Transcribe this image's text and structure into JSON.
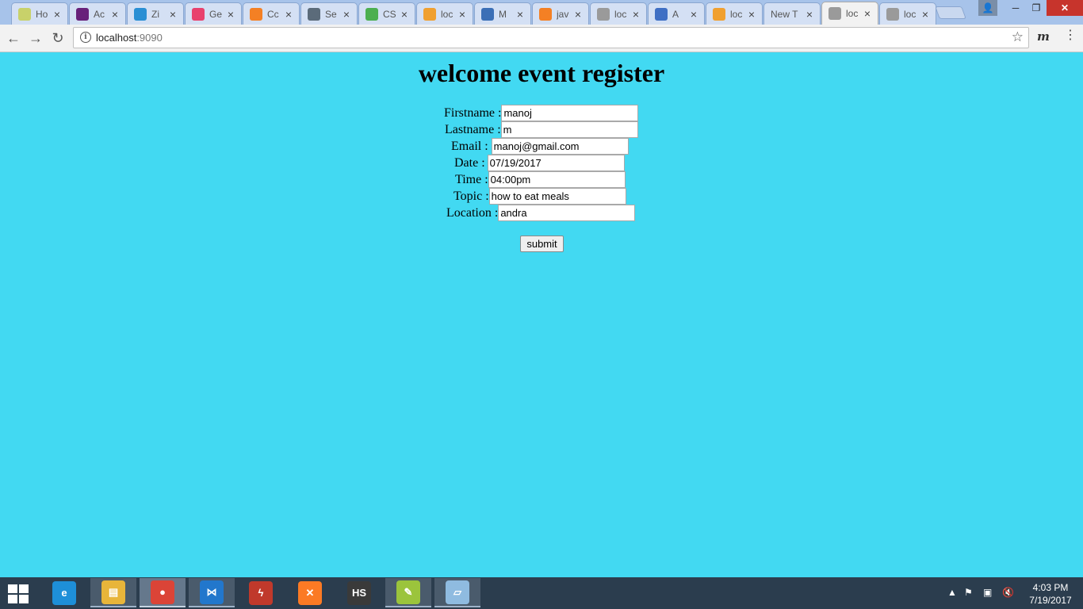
{
  "browser": {
    "tabs": [
      {
        "title": "Ho",
        "icon": "java-icon",
        "color": "#c8d16a"
      },
      {
        "title": "Ac",
        "icon": "visual-studio-icon",
        "color": "#68217a"
      },
      {
        "title": "Zi",
        "icon": "z-app-icon",
        "color": "#2a8fd4"
      },
      {
        "title": "Ge",
        "icon": "m-logo-icon",
        "color": "#e8416d"
      },
      {
        "title": "Cc",
        "icon": "stack-overflow-icon",
        "color": "#f48024"
      },
      {
        "title": "Se",
        "icon": "diamond-icon",
        "color": "#5b6b7a"
      },
      {
        "title": "CS",
        "icon": "css-icon",
        "color": "#4caf50"
      },
      {
        "title": "loc",
        "icon": "phpmyadmin-icon",
        "color": "#f0a030"
      },
      {
        "title": "M",
        "icon": "mvn-icon",
        "color": "#3b6fb6"
      },
      {
        "title": "jav",
        "icon": "stack-overflow-icon",
        "color": "#f48024"
      },
      {
        "title": "loc",
        "icon": "page-icon",
        "color": "#9a9a9a"
      },
      {
        "title": "A",
        "icon": "a-circle-icon",
        "color": "#3f6fc4"
      },
      {
        "title": "loc",
        "icon": "phpmyadmin-icon",
        "color": "#f0a030"
      },
      {
        "title": "New T",
        "icon": "",
        "color": ""
      },
      {
        "title": "loc",
        "icon": "page-icon",
        "color": "#9a9a9a",
        "active": true
      },
      {
        "title": "loc",
        "icon": "page-icon",
        "color": "#9a9a9a"
      }
    ],
    "close_glyph": "×",
    "url_host": "localhost",
    "url_port": ":9090"
  },
  "page": {
    "title": "welcome event register",
    "fields": [
      {
        "label": "Firstname :",
        "value": "manoj"
      },
      {
        "label": "Lastname :",
        "value": "m"
      },
      {
        "label": "Email :",
        "value": "manoj@gmail.com"
      },
      {
        "label": "Date :",
        "value": "07/19/2017"
      },
      {
        "label": "Time :",
        "value": "04:00pm"
      },
      {
        "label": "Topic :",
        "value": "how to eat meals"
      },
      {
        "label": "Location :",
        "value": "andra"
      }
    ],
    "submit_label": "submit"
  },
  "taskbar": {
    "apps": [
      {
        "name": "internet-explorer-icon",
        "color": "#1e8fd8",
        "glyph": "e"
      },
      {
        "name": "file-explorer-icon",
        "color": "#e8b53a",
        "glyph": "▤"
      },
      {
        "name": "chrome-icon",
        "color": "#db4437",
        "glyph": "●"
      },
      {
        "name": "visual-studio-code-icon",
        "color": "#2277cc",
        "glyph": "⋈"
      },
      {
        "name": "filezilla-icon",
        "color": "#c0392b",
        "glyph": "ϟ"
      },
      {
        "name": "xampp-icon",
        "color": "#fb7a24",
        "glyph": "✕"
      },
      {
        "name": "hs-app-icon",
        "color": "#3a3a3a",
        "glyph": "HS"
      },
      {
        "name": "notepad-plus-icon",
        "color": "#9bc43c",
        "glyph": "✎"
      },
      {
        "name": "notepad-icon",
        "color": "#8fbbe0",
        "glyph": "▱"
      }
    ],
    "clock_time": "4:03 PM",
    "clock_date": "7/19/2017"
  },
  "colors": {
    "page_background": "#42d9f2",
    "taskbar": "#2b3d4e"
  }
}
